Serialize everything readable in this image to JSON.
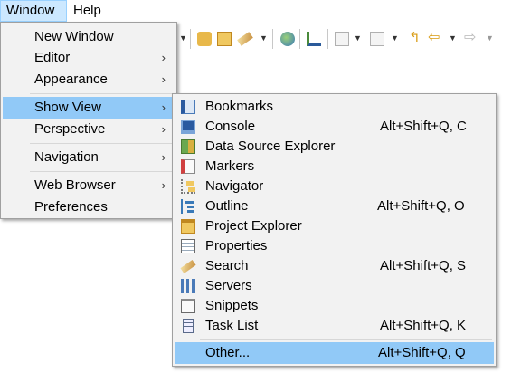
{
  "menubar": {
    "window": "Window",
    "help": "Help"
  },
  "window_menu": {
    "items": [
      {
        "label": "New Window",
        "submenu": false
      },
      {
        "label": "Editor",
        "submenu": true
      },
      {
        "label": "Appearance",
        "submenu": true
      },
      {
        "label": "Show View",
        "submenu": true,
        "highlighted": true
      },
      {
        "label": "Perspective",
        "submenu": true
      },
      {
        "label": "Navigation",
        "submenu": true
      },
      {
        "label": "Web Browser",
        "submenu": true
      },
      {
        "label": "Preferences",
        "submenu": false
      }
    ],
    "submenu_arrow": "›"
  },
  "show_view_menu": {
    "items": [
      {
        "label": "Bookmarks",
        "shortcut": "",
        "icon": "bookmarks-icon"
      },
      {
        "label": "Console",
        "shortcut": "Alt+Shift+Q, C",
        "icon": "console-icon"
      },
      {
        "label": "Data Source Explorer",
        "shortcut": "",
        "icon": "data-source-explorer-icon"
      },
      {
        "label": "Markers",
        "shortcut": "",
        "icon": "markers-icon"
      },
      {
        "label": "Navigator",
        "shortcut": "",
        "icon": "navigator-icon"
      },
      {
        "label": "Outline",
        "shortcut": "Alt+Shift+Q, O",
        "icon": "outline-icon"
      },
      {
        "label": "Project Explorer",
        "shortcut": "",
        "icon": "project-explorer-icon"
      },
      {
        "label": "Properties",
        "shortcut": "",
        "icon": "properties-icon"
      },
      {
        "label": "Search",
        "shortcut": "Alt+Shift+Q, S",
        "icon": "search-icon"
      },
      {
        "label": "Servers",
        "shortcut": "",
        "icon": "servers-icon"
      },
      {
        "label": "Snippets",
        "shortcut": "",
        "icon": "snippets-icon"
      },
      {
        "label": "Task List",
        "shortcut": "Alt+Shift+Q, K",
        "icon": "task-list-icon"
      },
      {
        "label": "Other...",
        "shortcut": "Alt+Shift+Q, Q",
        "highlighted": true
      }
    ]
  },
  "colors": {
    "highlight": "#91c9f7",
    "menu_bg": "#f2f2f2",
    "menubar_active": "#cce8ff"
  }
}
